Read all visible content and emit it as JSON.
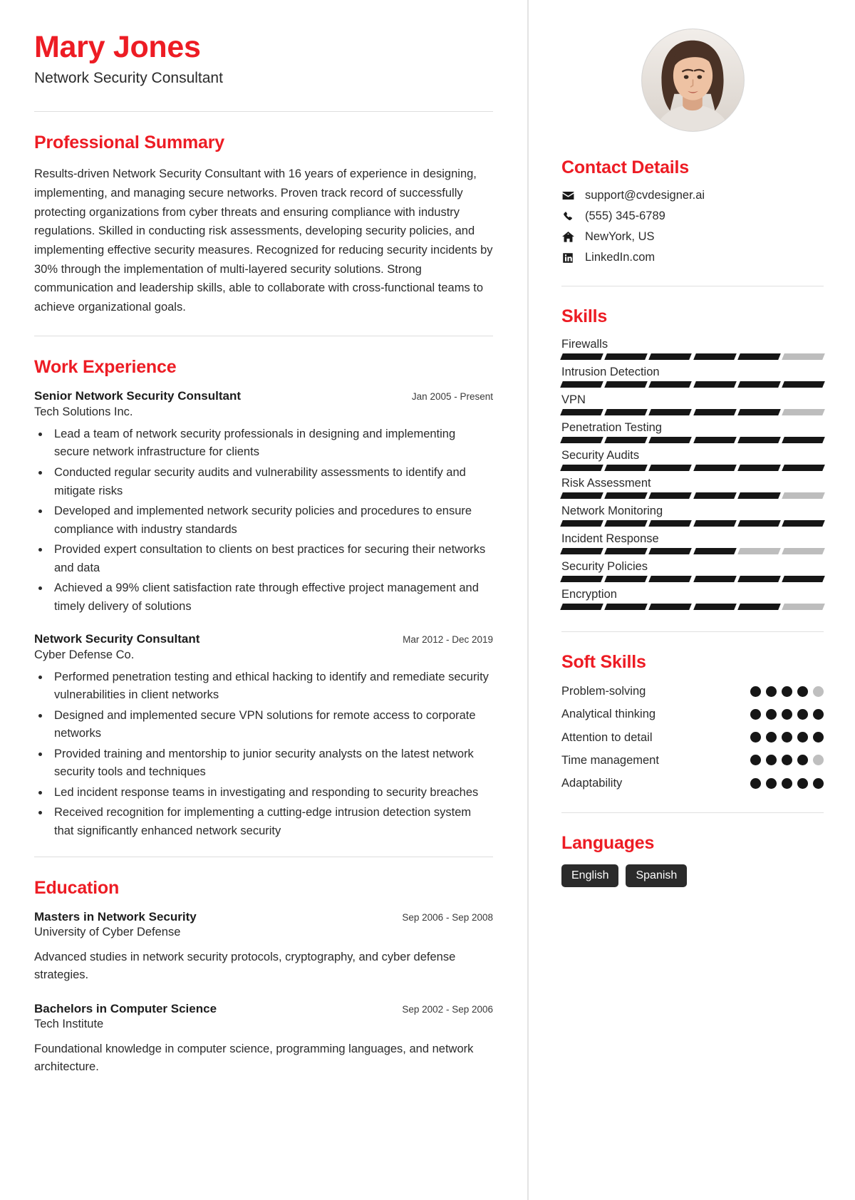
{
  "accent_color": "#ED1C24",
  "text_color": "#2b2b2b",
  "header": {
    "name": "Mary Jones",
    "job_title": "Network Security Consultant"
  },
  "summary": {
    "title": "Professional Summary",
    "text": "Results-driven Network Security Consultant with 16 years of experience in designing, implementing, and managing secure networks. Proven track record of successfully protecting organizations from cyber threats and ensuring compliance with industry regulations. Skilled in conducting risk assessments, developing security policies, and implementing effective security measures. Recognized for reducing security incidents by 30% through the implementation of multi-layered security solutions. Strong communication and leadership skills, able to collaborate with cross-functional teams to achieve organizational goals."
  },
  "work": {
    "title": "Work Experience",
    "items": [
      {
        "role": "Senior Network Security Consultant",
        "date": "Jan 2005 - Present",
        "company": "Tech Solutions Inc.",
        "bullets": [
          "Lead a team of network security professionals in designing and implementing secure network infrastructure for clients",
          "Conducted regular security audits and vulnerability assessments to identify and mitigate risks",
          "Developed and implemented network security policies and procedures to ensure compliance with industry standards",
          "Provided expert consultation to clients on best practices for securing their networks and data",
          "Achieved a 99% client satisfaction rate through effective project management and timely delivery of solutions"
        ]
      },
      {
        "role": "Network Security Consultant",
        "date": "Mar 2012 - Dec 2019",
        "company": "Cyber Defense Co.",
        "bullets": [
          "Performed penetration testing and ethical hacking to identify and remediate security vulnerabilities in client networks",
          "Designed and implemented secure VPN solutions for remote access to corporate networks",
          "Provided training and mentorship to junior security analysts on the latest network security tools and techniques",
          "Led incident response teams in investigating and responding to security breaches",
          "Received recognition for implementing a cutting-edge intrusion detection system that significantly enhanced network security"
        ]
      }
    ]
  },
  "education": {
    "title": "Education",
    "items": [
      {
        "degree": "Masters in Network Security",
        "date": "Sep 2006 - Sep 2008",
        "school": "University of Cyber Defense",
        "description": "Advanced studies in network security protocols, cryptography, and cyber defense strategies."
      },
      {
        "degree": "Bachelors in Computer Science",
        "date": "Sep 2002 - Sep 2006",
        "school": "Tech Institute",
        "description": "Foundational knowledge in computer science, programming languages, and network architecture."
      }
    ]
  },
  "contact": {
    "title": "Contact Details",
    "items": [
      {
        "icon": "envelope-icon",
        "value": "support@cvdesigner.ai"
      },
      {
        "icon": "phone-icon",
        "value": "(555) 345-6789"
      },
      {
        "icon": "home-icon",
        "value": "NewYork, US"
      },
      {
        "icon": "linkedin-icon",
        "value": "LinkedIn.com"
      }
    ]
  },
  "skills": {
    "title": "Skills",
    "segments_total": 6,
    "items": [
      {
        "name": "Firewalls",
        "filled": 5
      },
      {
        "name": "Intrusion Detection",
        "filled": 6
      },
      {
        "name": "VPN",
        "filled": 5
      },
      {
        "name": "Penetration Testing",
        "filled": 6
      },
      {
        "name": "Security Audits",
        "filled": 6
      },
      {
        "name": "Risk Assessment",
        "filled": 5
      },
      {
        "name": "Network Monitoring",
        "filled": 6
      },
      {
        "name": "Incident Response",
        "filled": 4
      },
      {
        "name": "Security Policies",
        "filled": 6
      },
      {
        "name": "Encryption",
        "filled": 5
      }
    ]
  },
  "soft_skills": {
    "title": "Soft Skills",
    "dots_total": 5,
    "items": [
      {
        "name": "Problem-solving",
        "filled": 4
      },
      {
        "name": "Analytical thinking",
        "filled": 5
      },
      {
        "name": "Attention to detail",
        "filled": 5
      },
      {
        "name": "Time management",
        "filled": 4
      },
      {
        "name": "Adaptability",
        "filled": 5
      }
    ]
  },
  "languages": {
    "title": "Languages",
    "items": [
      "English",
      "Spanish"
    ]
  }
}
